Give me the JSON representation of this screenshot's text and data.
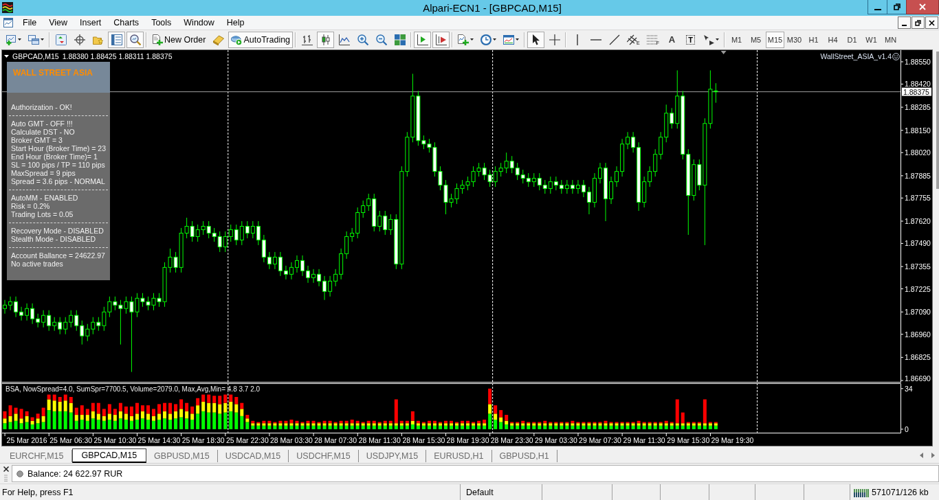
{
  "window": {
    "title": "Alpari-ECN1 - [GBPCAD,M15]"
  },
  "menu": {
    "items": [
      "File",
      "View",
      "Insert",
      "Charts",
      "Tools",
      "Window",
      "Help"
    ]
  },
  "toolbar": {
    "groups": [
      [
        {
          "kind": "newchart",
          "on": false
        },
        {
          "kind": "profiles",
          "on": false
        }
      ],
      [
        {
          "kind": "marketwatch",
          "on": false
        },
        {
          "kind": "datawindow",
          "on": false
        },
        {
          "kind": "navigator",
          "on": false
        },
        {
          "kind": "terminal",
          "on": true
        },
        {
          "kind": "tester",
          "on": true
        }
      ],
      [
        {
          "kind": "order",
          "label": "New Order",
          "on": false
        },
        {
          "kind": "editor",
          "on": false
        },
        {
          "kind": "autotrading",
          "label": "AutoTrading",
          "on": true
        }
      ],
      [
        {
          "kind": "bars",
          "on": false
        },
        {
          "kind": "candles",
          "on": true
        },
        {
          "kind": "line",
          "on": false
        },
        {
          "kind": "zoomin",
          "on": false
        },
        {
          "kind": "zoomout",
          "on": false
        },
        {
          "kind": "tile",
          "on": false
        }
      ],
      [
        {
          "kind": "autoscroll",
          "on": true
        },
        {
          "kind": "shift",
          "on": true
        }
      ],
      [
        {
          "kind": "indicators",
          "on": false
        },
        {
          "kind": "periods",
          "on": false
        },
        {
          "kind": "templates",
          "on": false
        }
      ],
      [
        {
          "kind": "cursor",
          "on": true
        },
        {
          "kind": "crosshair",
          "on": false
        }
      ],
      [
        {
          "kind": "vline",
          "on": false
        },
        {
          "kind": "hline",
          "on": false
        },
        {
          "kind": "trend",
          "on": false
        },
        {
          "kind": "channel",
          "label": "E",
          "on": false
        },
        {
          "kind": "fibo",
          "label": "F",
          "on": false
        },
        {
          "kind": "text",
          "label": "A",
          "on": false
        },
        {
          "kind": "label",
          "label": "T",
          "on": false
        },
        {
          "kind": "arrows",
          "on": false
        }
      ]
    ],
    "timeframes": [
      {
        "label": "M1",
        "selected": false
      },
      {
        "label": "M5",
        "selected": false
      },
      {
        "label": "M15",
        "selected": true
      },
      {
        "label": "M30",
        "selected": false
      },
      {
        "label": "H1",
        "selected": false
      },
      {
        "label": "H4",
        "selected": false
      },
      {
        "label": "D1",
        "selected": false
      },
      {
        "label": "W1",
        "selected": false
      },
      {
        "label": "MN",
        "selected": false
      }
    ]
  },
  "chart": {
    "expert": {
      "name": "WallStreet_ASIA_v1.4",
      "trading_allowed": true
    },
    "info_panel": {
      "title": "WALL STREET ASIA",
      "sections": [
        [
          "Authorization - OK!"
        ],
        [
          "Auto GMT - OFF !!!",
          "Calculate DST - NO",
          "Broker GMT = 3",
          "Start Hour (Broker Time) = 23",
          "End Hour (Broker Time)= 1",
          "SL = 100 pips / TP = 110 pips",
          "MaxSpread = 9 pips",
          "Spread = 3.6 pips - NORMAL"
        ],
        [
          "AutoMM - ENABLED",
          "Risk = 0.2%",
          "Trading Lots = 0.05"
        ],
        [
          "Recovery Mode - DISABLED",
          "Stealth Mode - DISABLED"
        ],
        [
          "Account Ballance = 24622.97",
          "No active trades"
        ]
      ]
    },
    "chart_data": [
      {
        "type": "candlestick",
        "title": "GBPCAD,M15",
        "subtitle": "1.88380 1.88425 1.88311 1.88375",
        "tick_labels": "y",
        "color": "#00ff00",
        "ylim": [
          1.86678,
          1.88618
        ],
        "yticks": [
          {
            "value": 1.8669,
            "label": "1.86690"
          },
          {
            "value": 1.86825,
            "label": "1.86825"
          },
          {
            "value": 1.8696,
            "label": "1.86960"
          },
          {
            "value": 1.8709,
            "label": "1.87090"
          },
          {
            "value": 1.87225,
            "label": "1.87225"
          },
          {
            "value": 1.87355,
            "label": "1.87355"
          },
          {
            "value": 1.8749,
            "label": "1.87490"
          },
          {
            "value": 1.8762,
            "label": "1.87620"
          },
          {
            "value": 1.87755,
            "label": "1.87755"
          },
          {
            "value": 1.87885,
            "label": "1.87885"
          },
          {
            "value": 1.8802,
            "label": "1.88020"
          },
          {
            "value": 1.8815,
            "label": "1.88150"
          },
          {
            "value": 1.88285,
            "label": "1.88285"
          },
          {
            "value": 1.8842,
            "label": "1.88420"
          },
          {
            "value": 1.8855,
            "label": "1.88550"
          }
        ],
        "ref_lines": [
          {
            "axis": "y",
            "value": 1.88375,
            "label": "1.88375",
            "color": "#a0a0a0"
          }
        ],
        "ohlc": [
          [
            1.8711,
            1.8716,
            1.8708,
            1.8713
          ],
          [
            1.8713,
            1.8718,
            1.871,
            1.8715
          ],
          [
            1.8715,
            1.8718,
            1.8706,
            1.8709
          ],
          [
            1.8709,
            1.8712,
            1.8704,
            1.8707
          ],
          [
            1.8707,
            1.8714,
            1.8704,
            1.8711
          ],
          [
            1.8711,
            1.8714,
            1.8702,
            1.8705
          ],
          [
            1.8705,
            1.8708,
            1.87,
            1.8703
          ],
          [
            1.8703,
            1.871,
            1.87,
            1.8707
          ],
          [
            1.8707,
            1.871,
            1.8698,
            1.8701
          ],
          [
            1.8701,
            1.8706,
            1.8698,
            1.8703
          ],
          [
            1.8703,
            1.8706,
            1.8696,
            1.8699
          ],
          [
            1.8699,
            1.8706,
            1.8696,
            1.8703
          ],
          [
            1.8703,
            1.871,
            1.87,
            1.8707
          ],
          [
            1.8707,
            1.871,
            1.8698,
            1.8701
          ],
          [
            1.8701,
            1.8704,
            1.869,
            1.8695
          ],
          [
            1.8695,
            1.8702,
            1.8692,
            1.8699
          ],
          [
            1.8699,
            1.8706,
            1.8696,
            1.8703
          ],
          [
            1.8703,
            1.8706,
            1.8698,
            1.8701
          ],
          [
            1.8701,
            1.8712,
            1.8698,
            1.8709
          ],
          [
            1.8709,
            1.8718,
            1.8706,
            1.8715
          ],
          [
            1.8715,
            1.8718,
            1.871,
            1.8713
          ],
          [
            1.8713,
            1.8716,
            1.869,
            1.8711
          ],
          [
            1.8711,
            1.8718,
            1.8708,
            1.8715
          ],
          [
            1.8715,
            1.8718,
            1.8674,
            1.8709
          ],
          [
            1.8709,
            1.872,
            1.8706,
            1.8717
          ],
          [
            1.8717,
            1.872,
            1.8712,
            1.8715
          ],
          [
            1.8715,
            1.8718,
            1.871,
            1.8713
          ],
          [
            1.8713,
            1.872,
            1.871,
            1.8717
          ],
          [
            1.8717,
            1.872,
            1.8712,
            1.8715
          ],
          [
            1.8715,
            1.8738,
            1.8712,
            1.8735
          ],
          [
            1.8735,
            1.8746,
            1.8732,
            1.8741
          ],
          [
            1.8741,
            1.8744,
            1.8732,
            1.8735
          ],
          [
            1.8735,
            1.8758,
            1.8732,
            1.8755
          ],
          [
            1.8755,
            1.8764,
            1.8752,
            1.8759
          ],
          [
            1.8759,
            1.8762,
            1.875,
            1.8753
          ],
          [
            1.8753,
            1.876,
            1.875,
            1.8757
          ],
          [
            1.8757,
            1.8762,
            1.8754,
            1.8759
          ],
          [
            1.8759,
            1.8762,
            1.8752,
            1.8755
          ],
          [
            1.8755,
            1.8758,
            1.875,
            1.8753
          ],
          [
            1.8753,
            1.8756,
            1.8744,
            1.8747
          ],
          [
            1.8747,
            1.8756,
            1.8744,
            1.8753
          ],
          [
            1.8753,
            1.876,
            1.875,
            1.8757
          ],
          [
            1.8757,
            1.876,
            1.8748,
            1.8751
          ],
          [
            1.8751,
            1.8762,
            1.8748,
            1.8759
          ],
          [
            1.8759,
            1.8762,
            1.8752,
            1.8755
          ],
          [
            1.8755,
            1.8762,
            1.8752,
            1.8759
          ],
          [
            1.8759,
            1.8762,
            1.8748,
            1.8751
          ],
          [
            1.8751,
            1.8754,
            1.8738,
            1.8741
          ],
          [
            1.8741,
            1.8744,
            1.8734,
            1.8737
          ],
          [
            1.8737,
            1.8744,
            1.8734,
            1.8741
          ],
          [
            1.8741,
            1.8744,
            1.873,
            1.8733
          ],
          [
            1.8733,
            1.8736,
            1.8728,
            1.8731
          ],
          [
            1.8731,
            1.8738,
            1.8728,
            1.8735
          ],
          [
            1.8735,
            1.8742,
            1.8732,
            1.8739
          ],
          [
            1.8739,
            1.8742,
            1.873,
            1.8733
          ],
          [
            1.8733,
            1.8736,
            1.8726,
            1.8729
          ],
          [
            1.8729,
            1.8734,
            1.8726,
            1.8731
          ],
          [
            1.8731,
            1.8734,
            1.8724,
            1.8727
          ],
          [
            1.8727,
            1.873,
            1.8716,
            1.8721
          ],
          [
            1.8721,
            1.873,
            1.8718,
            1.8727
          ],
          [
            1.8727,
            1.8734,
            1.8724,
            1.8731
          ],
          [
            1.8731,
            1.8746,
            1.8728,
            1.8743
          ],
          [
            1.8743,
            1.8756,
            1.874,
            1.8753
          ],
          [
            1.8753,
            1.8758,
            1.875,
            1.8755
          ],
          [
            1.8755,
            1.877,
            1.8752,
            1.8767
          ],
          [
            1.8767,
            1.8774,
            1.8764,
            1.8771
          ],
          [
            1.8771,
            1.8778,
            1.8768,
            1.8775
          ],
          [
            1.8775,
            1.8778,
            1.8756,
            1.8759
          ],
          [
            1.8759,
            1.8768,
            1.8756,
            1.8765
          ],
          [
            1.8765,
            1.8768,
            1.8754,
            1.8757
          ],
          [
            1.8757,
            1.8766,
            1.8754,
            1.8763
          ],
          [
            1.8763,
            1.8766,
            1.8734,
            1.8737
          ],
          [
            1.8737,
            1.8794,
            1.8734,
            1.8791
          ],
          [
            1.8791,
            1.8814,
            1.8788,
            1.8811
          ],
          [
            1.8811,
            1.8848,
            1.8808,
            1.8835
          ],
          [
            1.8835,
            1.8838,
            1.8806,
            1.8809
          ],
          [
            1.8809,
            1.8812,
            1.8804,
            1.8807
          ],
          [
            1.8807,
            1.881,
            1.8802,
            1.8805
          ],
          [
            1.8805,
            1.8808,
            1.8788,
            1.8791
          ],
          [
            1.8791,
            1.8794,
            1.878,
            1.8783
          ],
          [
            1.8783,
            1.8786,
            1.8766,
            1.8773
          ],
          [
            1.8773,
            1.8778,
            1.877,
            1.8775
          ],
          [
            1.8775,
            1.8784,
            1.8772,
            1.8781
          ],
          [
            1.8781,
            1.8786,
            1.8778,
            1.8783
          ],
          [
            1.8783,
            1.8788,
            1.878,
            1.8785
          ],
          [
            1.8785,
            1.8794,
            1.8782,
            1.8791
          ],
          [
            1.8791,
            1.8796,
            1.8788,
            1.8793
          ],
          [
            1.8793,
            1.8796,
            1.8786,
            1.8789
          ],
          [
            1.8789,
            1.8792,
            1.8782,
            1.8785
          ],
          [
            1.8785,
            1.8794,
            1.8782,
            1.8791
          ],
          [
            1.8791,
            1.8796,
            1.8788,
            1.8793
          ],
          [
            1.8793,
            1.8802,
            1.879,
            1.8797
          ],
          [
            1.8797,
            1.88,
            1.879,
            1.8793
          ],
          [
            1.8793,
            1.8796,
            1.8786,
            1.8789
          ],
          [
            1.8789,
            1.8792,
            1.8784,
            1.8787
          ],
          [
            1.8787,
            1.879,
            1.8782,
            1.8785
          ],
          [
            1.8785,
            1.879,
            1.8782,
            1.8787
          ],
          [
            1.8787,
            1.879,
            1.878,
            1.8783
          ],
          [
            1.8783,
            1.8786,
            1.8778,
            1.8781
          ],
          [
            1.8781,
            1.8788,
            1.8778,
            1.8785
          ],
          [
            1.8785,
            1.8788,
            1.878,
            1.8783
          ],
          [
            1.8783,
            1.8786,
            1.8778,
            1.8781
          ],
          [
            1.8781,
            1.8786,
            1.8778,
            1.8783
          ],
          [
            1.8783,
            1.8786,
            1.8778,
            1.8781
          ],
          [
            1.8781,
            1.8786,
            1.8778,
            1.8783
          ],
          [
            1.8783,
            1.8786,
            1.8776,
            1.8779
          ],
          [
            1.8779,
            1.8782,
            1.8766,
            1.8773
          ],
          [
            1.8773,
            1.879,
            1.877,
            1.8787
          ],
          [
            1.8787,
            1.8796,
            1.8784,
            1.8793
          ],
          [
            1.8793,
            1.8796,
            1.8762,
            1.8775
          ],
          [
            1.8775,
            1.8788,
            1.8772,
            1.8785
          ],
          [
            1.8785,
            1.8794,
            1.8782,
            1.8791
          ],
          [
            1.8791,
            1.881,
            1.8788,
            1.8807
          ],
          [
            1.8807,
            1.8814,
            1.8804,
            1.8811
          ],
          [
            1.8811,
            1.8814,
            1.8802,
            1.8805
          ],
          [
            1.8805,
            1.8808,
            1.8768,
            1.8773
          ],
          [
            1.8773,
            1.8788,
            1.877,
            1.8785
          ],
          [
            1.8785,
            1.8794,
            1.8782,
            1.8791
          ],
          [
            1.8791,
            1.8804,
            1.8788,
            1.8801
          ],
          [
            1.8801,
            1.8814,
            1.8798,
            1.8811
          ],
          [
            1.8811,
            1.883,
            1.8808,
            1.8825
          ],
          [
            1.8825,
            1.8828,
            1.8816,
            1.8819
          ],
          [
            1.8819,
            1.885,
            1.8816,
            1.8835
          ],
          [
            1.8835,
            1.8838,
            1.8798,
            1.8801
          ],
          [
            1.8801,
            1.8804,
            1.8754,
            1.8777
          ],
          [
            1.8777,
            1.8798,
            1.8774,
            1.8795
          ],
          [
            1.8795,
            1.8798,
            1.878,
            1.8783
          ],
          [
            1.8783,
            1.8822,
            1.8748,
            1.8819
          ],
          [
            1.8819,
            1.885,
            1.8816,
            1.8839
          ],
          [
            1.8838,
            1.88425,
            1.88311,
            1.88375
          ],
          null,
          null,
          null,
          null,
          null,
          null,
          null,
          null,
          null,
          null,
          null,
          null,
          null,
          null,
          null,
          null,
          null,
          null,
          null,
          null,
          null,
          null,
          null,
          null,
          null,
          null,
          null,
          null,
          null,
          null,
          null,
          null,
          null
        ]
      },
      {
        "type": "bar",
        "stacked": true,
        "title": "BSA, NowSpread=4.0, SumSpr=7700.5, Volume=2079.0, Max,Avg,Min= 4.8 3.7 2.0",
        "ylim": [
          -3.5,
          38.5
        ],
        "yticks": [
          0,
          34
        ],
        "categories": [
          null,
          null,
          null,
          null,
          "25 Mar 2016",
          null,
          null,
          null,
          null,
          null,
          null,
          null,
          "25 Mar 06:30",
          null,
          null,
          null,
          null,
          null,
          null,
          null,
          "25 Mar 10:30",
          null,
          null,
          null,
          null,
          null,
          null,
          null,
          "25 Mar 14:30",
          null,
          null,
          null,
          null,
          null,
          null,
          null,
          "25 Mar 18:30",
          null,
          null,
          null,
          null,
          null,
          null,
          null,
          "25 Mar 22:30",
          null,
          null,
          null,
          null,
          null,
          null,
          null,
          "28 Mar 03:30",
          null,
          null,
          null,
          null,
          null,
          null,
          null,
          "28 Mar 07:30",
          null,
          null,
          null,
          null,
          null,
          null,
          null,
          "28 Mar 11:30",
          null,
          null,
          null,
          null,
          null,
          null,
          null,
          "28 Mar 15:30",
          null,
          null,
          null,
          null,
          null,
          null,
          null,
          "28 Mar 19:30",
          null,
          null,
          null,
          null,
          null,
          null,
          null,
          "28 Mar 23:30",
          null,
          null,
          null,
          null,
          null,
          null,
          null,
          "29 Mar 03:30",
          null,
          null,
          null,
          null,
          null,
          null,
          null,
          "29 Mar 07:30",
          null,
          null,
          null,
          null,
          null,
          null,
          null,
          "29 Mar 11:30",
          null,
          null,
          null,
          null,
          null,
          null,
          null,
          "29 Mar 15:30",
          null,
          null,
          null,
          null,
          null,
          null,
          null,
          "29 Mar 19:30",
          null,
          null,
          null,
          null,
          null,
          null,
          null,
          null,
          null,
          null,
          null,
          null,
          null,
          null,
          null,
          null,
          null,
          null,
          null,
          null,
          null,
          null,
          null,
          null,
          null,
          null,
          null,
          null,
          null,
          null
        ],
        "series": [
          {
            "color": "#00ff00",
            "values": [
              5,
              6,
              7,
              5,
              6,
              4,
              5,
              6,
              16,
              15,
              15,
              15,
              14,
              7,
              8,
              7,
              9,
              8,
              7,
              8,
              7,
              9,
              8,
              7,
              8,
              9,
              8,
              7,
              8,
              9,
              8,
              9,
              10,
              9,
              8,
              13,
              15,
              14,
              14,
              13,
              14,
              15,
              14,
              11,
              6,
              3,
              3,
              3,
              3,
              3,
              3,
              3,
              3,
              3,
              3,
              3,
              3,
              3,
              3,
              3,
              3,
              3,
              3,
              3,
              3,
              3,
              3,
              3,
              3,
              3,
              3,
              3,
              3,
              3,
              4,
              3,
              3,
              3,
              3,
              3,
              3,
              3,
              3,
              3,
              3,
              3,
              3,
              3,
              13,
              8,
              6,
              4,
              3,
              3,
              3,
              3,
              3,
              3,
              3,
              3,
              3,
              3,
              3,
              3,
              3,
              3,
              3,
              3,
              3,
              3,
              3,
              3,
              3,
              3,
              3,
              3,
              3,
              3,
              3,
              3,
              3,
              3,
              3,
              3,
              3,
              3,
              3,
              3,
              3,
              3,
              null,
              null,
              null,
              null,
              null,
              null,
              null,
              null,
              null,
              null,
              null,
              null,
              null,
              null,
              null,
              null,
              null,
              null,
              null,
              null,
              null,
              null,
              null,
              null,
              null,
              null,
              null,
              null,
              null,
              null,
              null,
              null,
              null
            ]
          },
          {
            "color": "#ffff00",
            "values": [
              4,
              5,
              6,
              4,
              5,
              3,
              4,
              5,
              9,
              9,
              8,
              9,
              8,
              5,
              4,
              5,
              6,
              5,
              4,
              5,
              5,
              6,
              5,
              4,
              5,
              6,
              5,
              4,
              5,
              6,
              5,
              6,
              7,
              6,
              5,
              7,
              8,
              8,
              8,
              8,
              8,
              8,
              7,
              6,
              3,
              2,
              2,
              2,
              2,
              2,
              2,
              2,
              2,
              2,
              2,
              2,
              2,
              2,
              2,
              2,
              2,
              2,
              2,
              2,
              2,
              2,
              2,
              2,
              2,
              2,
              2,
              2,
              2,
              2,
              3,
              2,
              2,
              2,
              2,
              2,
              2,
              2,
              2,
              2,
              2,
              2,
              2,
              2,
              8,
              5,
              4,
              3,
              2,
              2,
              2,
              2,
              2,
              2,
              2,
              2,
              2,
              2,
              2,
              2,
              2,
              2,
              2,
              2,
              2,
              2,
              2,
              2,
              2,
              2,
              2,
              2,
              2,
              2,
              2,
              2,
              2,
              2,
              2,
              2,
              2,
              2,
              2,
              2,
              2,
              2,
              null,
              null,
              null,
              null,
              null,
              null,
              null,
              null,
              null,
              null,
              null,
              null,
              null,
              null,
              null,
              null,
              null,
              null,
              null,
              null,
              null,
              null,
              null,
              null,
              null,
              null,
              null,
              null,
              null,
              null,
              null,
              null,
              null
            ]
          },
          {
            "color": "#ff0000",
            "values": [
              6,
              9,
              5,
              8,
              4,
              3,
              4,
              7,
              4,
              5,
              4,
              5,
              5,
              6,
              8,
              5,
              7,
              9,
              6,
              8,
              5,
              7,
              6,
              8,
              9,
              5,
              7,
              6,
              8,
              7,
              9,
              6,
              8,
              7,
              6,
              6,
              6,
              7,
              6,
              7,
              7,
              6,
              6,
              5,
              3,
              2,
              1,
              2,
              2,
              1,
              2,
              2,
              3,
              2,
              1,
              2,
              2,
              1,
              2,
              2,
              1,
              2,
              2,
              3,
              2,
              1,
              2,
              2,
              1,
              2,
              2,
              20,
              2,
              2,
              8,
              2,
              1,
              2,
              2,
              1,
              2,
              2,
              1,
              2,
              2,
              1,
              2,
              3,
              13,
              7,
              6,
              5,
              1,
              1,
              2,
              1,
              1,
              1,
              2,
              1,
              1,
              1,
              1,
              2,
              1,
              1,
              1,
              1,
              1,
              2,
              1,
              1,
              1,
              1,
              1,
              2,
              1,
              1,
              1,
              1,
              2,
              1,
              20,
              9,
              1,
              1,
              1,
              20,
              1,
              1,
              null,
              null,
              null,
              null,
              null,
              null,
              null,
              null,
              null,
              null,
              null,
              null,
              null,
              null,
              null,
              null,
              null,
              null,
              null,
              null,
              null,
              null,
              null,
              null,
              null,
              null,
              null,
              null,
              null,
              null,
              null,
              null,
              null
            ]
          }
        ]
      }
    ]
  },
  "tabs": [
    {
      "label": "EURCHF,M15",
      "selected": false
    },
    {
      "label": "GBPCAD,M15",
      "selected": true
    },
    {
      "label": "GBPUSD,M15",
      "selected": false
    },
    {
      "label": "USDCAD,M15",
      "selected": false
    },
    {
      "label": "USDCHF,M15",
      "selected": false
    },
    {
      "label": "USDJPY,M15",
      "selected": false
    },
    {
      "label": "EURUSD,H1",
      "selected": false
    },
    {
      "label": "GBPUSD,H1",
      "selected": false
    }
  ],
  "toolbox": {
    "message": "Balance: 24 622.97 RUR"
  },
  "status_bar": {
    "help": "For Help, press F1",
    "profile": "Default",
    "traffic": "571071/126 kb"
  }
}
